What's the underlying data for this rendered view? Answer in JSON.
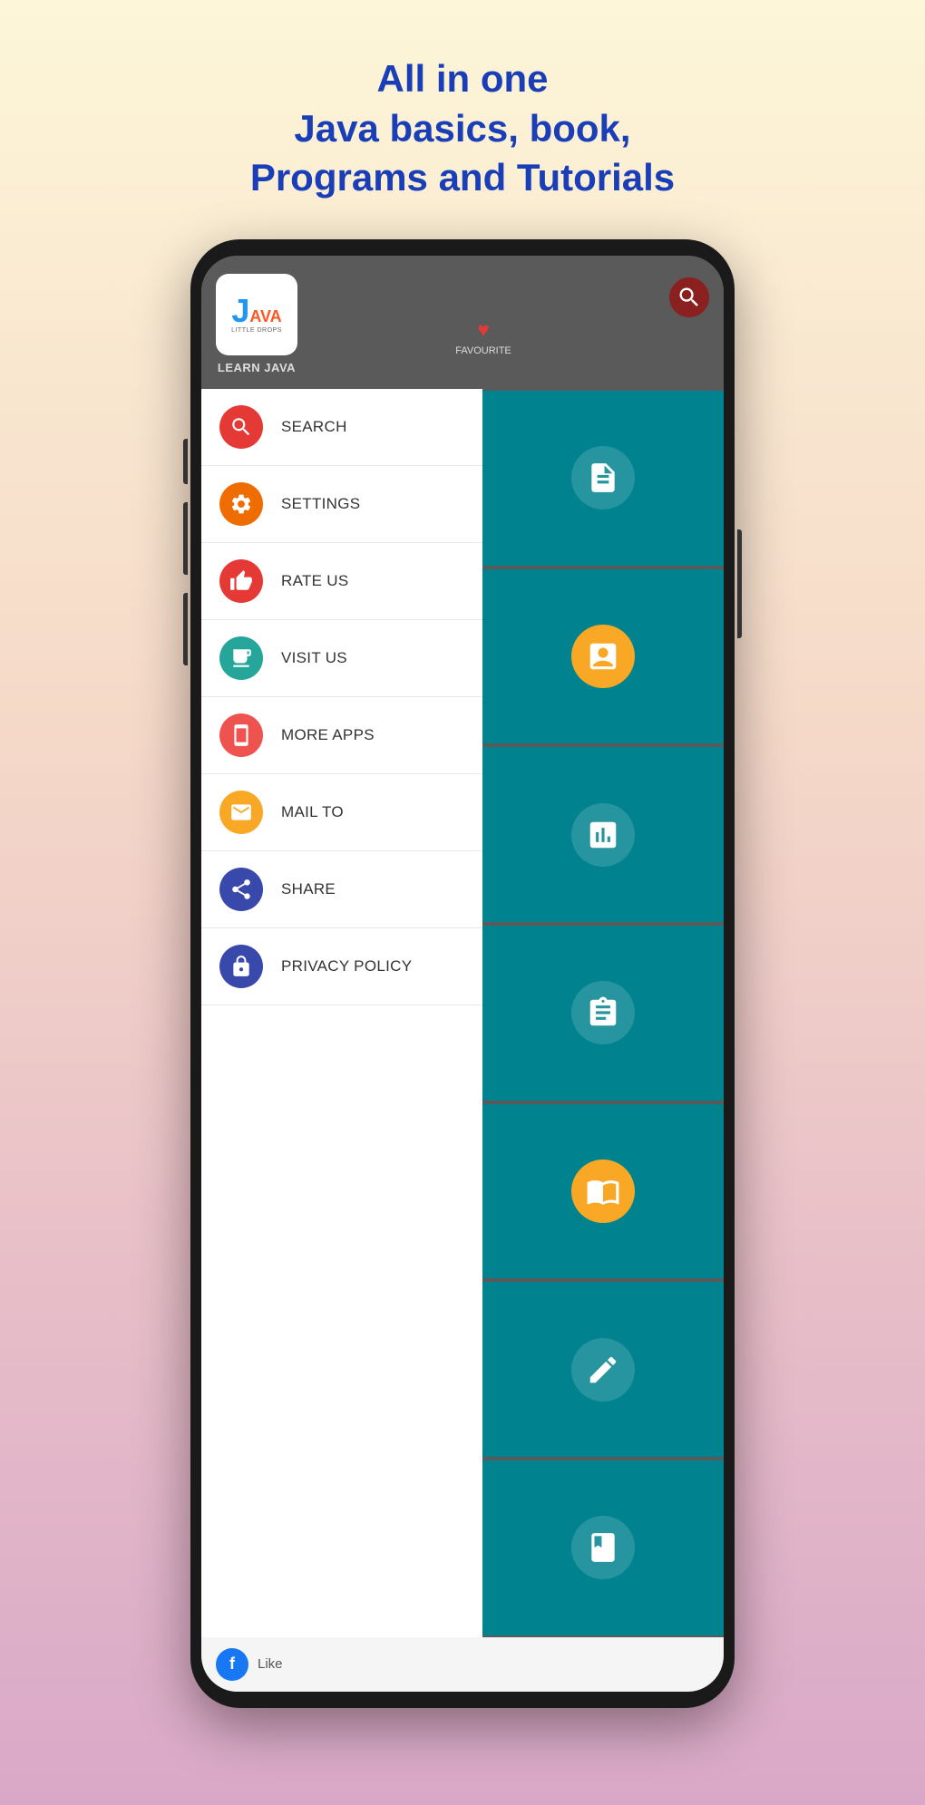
{
  "header": {
    "line1": "All in one",
    "line2": "Java basics, book,",
    "line3": "Programs and Tutorials"
  },
  "app": {
    "logo_letter": "J",
    "logo_letters": "AVA",
    "logo_sub": "LITTLE DROPS",
    "title": "LEARN JAVA"
  },
  "favourite": {
    "label": "FAVOURITE"
  },
  "menu_items": [
    {
      "id": "search",
      "label": "SEARCH",
      "icon_class": "icon-search",
      "icon_emoji": "🔍"
    },
    {
      "id": "settings",
      "label": "SETTINGS",
      "icon_class": "icon-settings",
      "icon_emoji": "⚙️"
    },
    {
      "id": "rate",
      "label": "RATE US",
      "icon_class": "icon-rate",
      "icon_emoji": "👍"
    },
    {
      "id": "visit",
      "label": "VISIT US",
      "icon_class": "icon-visit",
      "icon_emoji": "🖥️"
    },
    {
      "id": "more",
      "label": "MORE APPS",
      "icon_class": "icon-more",
      "icon_emoji": "📱"
    },
    {
      "id": "mail",
      "label": "MAIL TO",
      "icon_class": "icon-mail",
      "icon_emoji": "✉️"
    },
    {
      "id": "share",
      "label": "SHARE",
      "icon_class": "icon-share",
      "icon_emoji": "🔗"
    },
    {
      "id": "privacy",
      "label": "PRIVACY POLICY",
      "icon_class": "icon-privacy",
      "icon_emoji": "🔒"
    }
  ],
  "right_cards": [
    {
      "id": "card1",
      "icon": "📝",
      "icon_class": "card-icon-1"
    },
    {
      "id": "card2",
      "icon": "📊",
      "icon_class": "card-icon-2"
    },
    {
      "id": "card3",
      "icon": "🧮",
      "icon_class": "card-icon-3"
    },
    {
      "id": "card4",
      "icon": "📋",
      "icon_class": "card-icon-4"
    },
    {
      "id": "card5",
      "icon": "📚",
      "icon_class": "card-icon-5"
    },
    {
      "id": "card6",
      "icon": "✏️",
      "icon_class": "card-icon-6"
    },
    {
      "id": "card7",
      "icon": "📖",
      "icon_class": "card-icon-7"
    }
  ],
  "facebook": {
    "icon": "f",
    "label": "Like"
  }
}
